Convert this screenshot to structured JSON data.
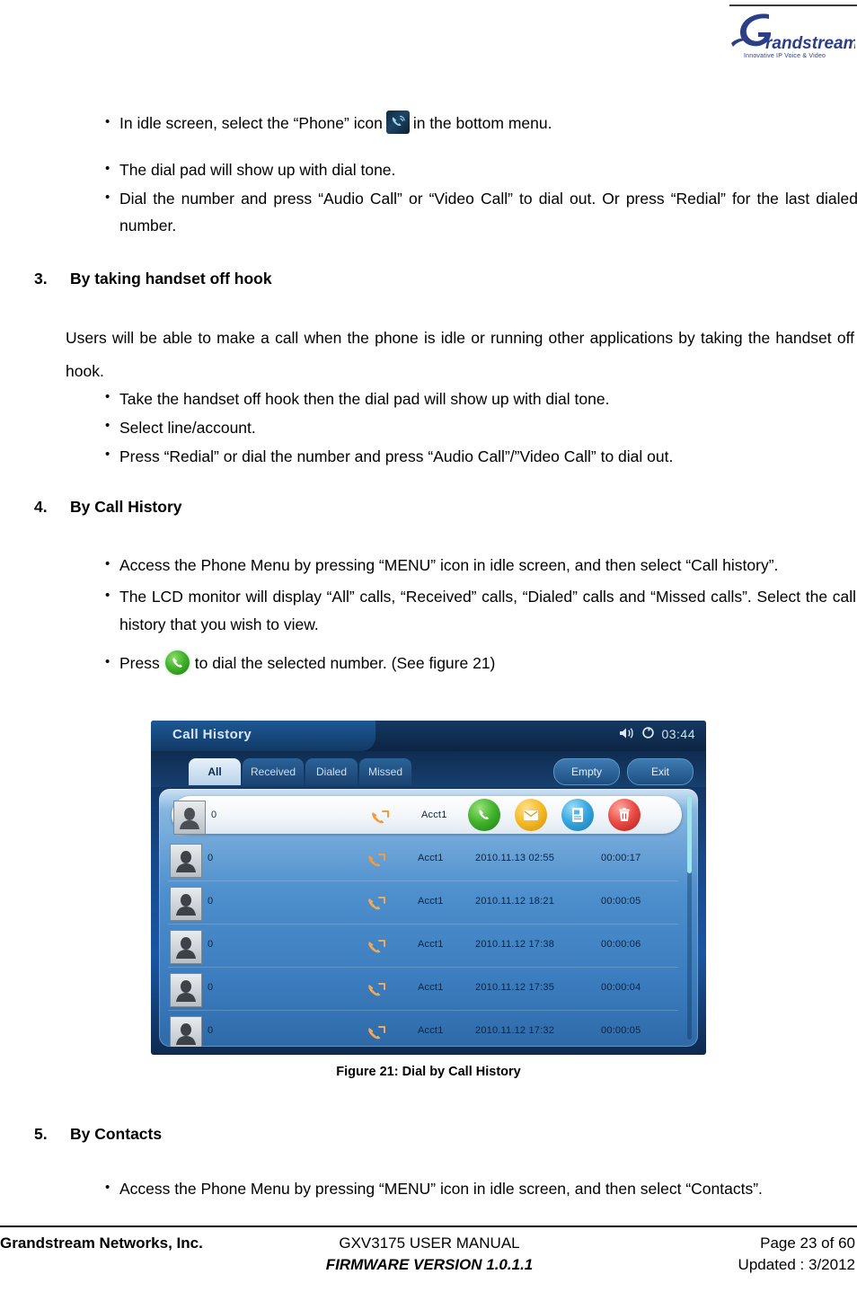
{
  "header": {
    "logo_name": "Grandstream",
    "logo_tagline": "Innovative IP Voice & Video"
  },
  "section_top": {
    "bullets": [
      {
        "before": "In idle screen, select the “Phone” icon",
        "icon": "phone-menu-icon",
        "after": "in the bottom menu."
      },
      {
        "text": "The dial pad will show up with dial tone."
      },
      {
        "text": "Dial the number and press “Audio Call” or “Video Call” to dial out. Or press “Redial” for the last dialed number."
      }
    ]
  },
  "section3": {
    "number": "3.",
    "title": "By taking handset off hook",
    "paragraph": "Users will be able to make a call when the phone is idle or running other applications by taking the handset off hook.",
    "bullets": [
      "Take the handset off hook then the dial pad will show up with dial tone.",
      "Select line/account.",
      "Press “Redial” or dial the number and press “Audio Call”/”Video Call” to dial out."
    ]
  },
  "section4": {
    "number": "4.",
    "title": "By Call History",
    "bullets": [
      "Access the Phone Menu by pressing “MENU” icon in idle screen, and then select “Call history”.",
      "The LCD monitor will display “All” calls, “Received” calls, “Dialed” calls and “Missed calls”. Select the call history that you wish to view."
    ],
    "press_bullet": {
      "before": "Press",
      "icon": "green-dial-icon",
      "after": "to dial the selected number. (See figure 21)"
    }
  },
  "figure": {
    "caption": "Figure 21: Dial by Call History",
    "lcd": {
      "title": "Call History",
      "status": {
        "speaker_icon": "speaker-icon",
        "sync_icon": "sync-icon",
        "clock": "03:44"
      },
      "tabs": [
        {
          "label": "All",
          "active": true
        },
        {
          "label": "Received",
          "active": false
        },
        {
          "label": "Dialed",
          "active": false
        },
        {
          "label": "Missed",
          "active": false
        }
      ],
      "buttons": [
        {
          "label": "Empty"
        },
        {
          "label": "Exit"
        }
      ],
      "actions": [
        {
          "name": "dial-action-icon",
          "color": "#42b22a"
        },
        {
          "name": "message-action-icon",
          "color": "#f5ba28"
        },
        {
          "name": "add-contact-action-icon",
          "color": "#35a7e0"
        },
        {
          "name": "delete-action-icon",
          "color": "#ea4c46"
        }
      ],
      "rows": [
        {
          "number": "0",
          "account": "Acct1",
          "date": "",
          "duration": "",
          "selected": true
        },
        {
          "number": "0",
          "account": "Acct1",
          "date": "2010.11.13  02:55",
          "duration": "00:00:17",
          "selected": false
        },
        {
          "number": "0",
          "account": "Acct1",
          "date": "2010.11.12  18:21",
          "duration": "00:00:05",
          "selected": false
        },
        {
          "number": "0",
          "account": "Acct1",
          "date": "2010.11.12  17:38",
          "duration": "00:00:06",
          "selected": false
        },
        {
          "number": "0",
          "account": "Acct1",
          "date": "2010.11.12  17:35",
          "duration": "00:00:04",
          "selected": false
        },
        {
          "number": "0",
          "account": "Acct1",
          "date": "2010.11.12  17:32",
          "duration": "00:00:05",
          "selected": false
        }
      ]
    }
  },
  "section5": {
    "number": "5.",
    "title": "By Contacts",
    "bullets": [
      "Access the Phone Menu by pressing “MENU” icon in idle screen, and then select “Contacts”."
    ]
  },
  "footer": {
    "company": "Grandstream Networks, Inc.",
    "manual": "GXV3175 USER MANUAL",
    "firmware": "FIRMWARE VERSION 1.0.1.1",
    "page": "Page 23 of 60",
    "updated": "Updated : 3/2012"
  }
}
